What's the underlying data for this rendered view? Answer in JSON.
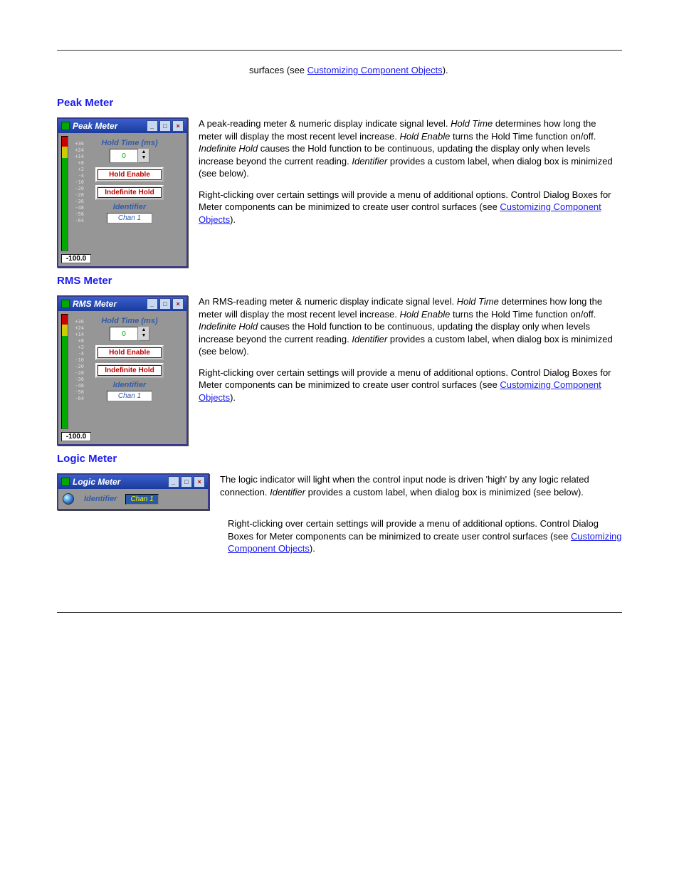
{
  "intro": {
    "surfaces_prefix": "surfaces (see ",
    "link": "Customizing Component Objects",
    "close": ")."
  },
  "peak": {
    "heading": "Peak Meter",
    "title": "Peak Meter",
    "hold_label": "Hold Time (ms)",
    "hold_value": "0",
    "hold_enable": "Hold Enable",
    "indef_hold": "Indefinite Hold",
    "identifier_label": "Identifier",
    "identifier_value": "Chan 1",
    "readout": "-100.0",
    "scale": "+36\n+24\n+14\n+8\n+2\n-4\n-10\n-20\n-28\n-36\n-48\n-56\n-64",
    "p1_a": "A peak-reading meter & numeric display indicate signal level. ",
    "t_hold": "Hold Time",
    "p1_b": " determines how long the meter will display the most recent level increase. ",
    "t_he": "Hold Enable",
    "p1_c": " turns the Hold Time function on/off. ",
    "t_ih": "Indefinite Hold",
    "p1_d": " causes the Hold function to be continuous, updating the display only when levels increase beyond the current reading. ",
    "t_id": "Identifier",
    "p1_e": " provides a custom label, when dialog box is minimized (see below).",
    "p2_a": "Right-clicking over certain settings will provide a menu of additional options. Control Dialog Boxes for Meter components can be minimized to create user control surfaces (see ",
    "p2_link": "Customizing Component Objects",
    "p2_b": ")."
  },
  "rms": {
    "heading": "RMS Meter",
    "title": "RMS Meter",
    "hold_label": "Hold Time (ms)",
    "hold_value": "0",
    "hold_enable": "Hold Enable",
    "indef_hold": "Indefinite Hold",
    "identifier_label": "Identifier",
    "identifier_value": "Chan 1",
    "readout": "-100.0",
    "scale": "+36\n+24\n+14\n+8\n+2\n-4\n-10\n-20\n-28\n-36\n-48\n-56\n-64",
    "p1_a": "An RMS-reading meter & numeric display indicate signal level. ",
    "t_hold": "Hold Time",
    "p1_b": " determines how long the meter will display the most recent level increase. ",
    "t_he": "Hold Enable",
    "p1_c": " turns the Hold Time function on/off. ",
    "t_ih": "Indefinite Hold",
    "p1_d": " causes the Hold function to be continuous, updating the display only when levels increase beyond the current reading. ",
    "t_id": "Identifier",
    "p1_e": " provides a custom label, when dialog box is minimized (see below).",
    "p2_a": "Right-clicking over certain settings will provide a menu of additional options. Control Dialog Boxes for Meter components can be minimized to create user control surfaces (see ",
    "p2_link": "Customizing Component Objects",
    "p2_b": ")."
  },
  "logic": {
    "heading": "Logic Meter",
    "title": "Logic Meter",
    "identifier_label": "Identifier",
    "identifier_value": "Chan 1",
    "p1_a": "The logic indicator will light when the control input node is driven 'high' by any logic related connection. ",
    "t_id": "Identifier",
    "p1_b": " provides a custom label, when dialog box is minimized (see below).",
    "p2_a": "Right-clicking over certain settings will provide a menu of additional options. Control Dialog Boxes for Meter components can be minimized to create user control surfaces (see ",
    "p2_link": "Customizing Component Objects",
    "p2_b": ")."
  }
}
